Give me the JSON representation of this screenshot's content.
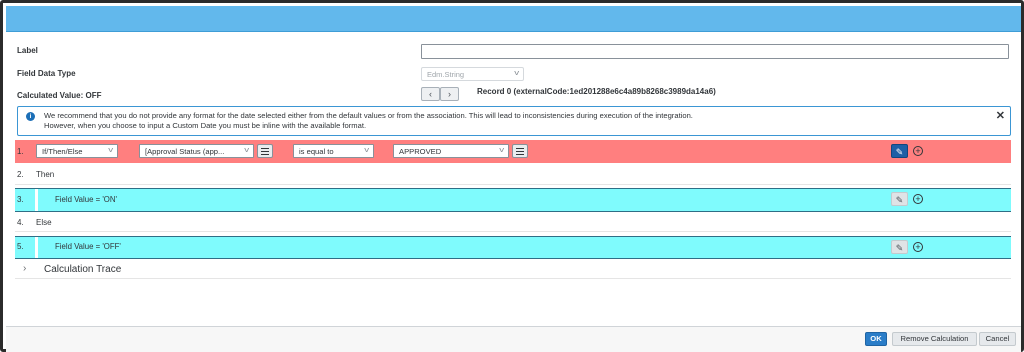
{
  "form": {
    "label_label": "Label",
    "label_value": "",
    "field_type_label": "Field Data Type",
    "field_type_value": "Edm.String",
    "calculated_value_label": "Calculated Value: OFF",
    "record_label": "Record 0 (externalCode:1ed201288e6c4a89b8268c3989da14a6)",
    "nav_prev": "‹",
    "nav_next": "›"
  },
  "info": {
    "line1": "We recommend that you do not provide any format for the date selected either from the default values or from the association. This will lead to inconsistencies during execution of the integration.",
    "line2": "However, when you choose to input a Custom Date you must be inline with the available format.",
    "icon": "info-icon",
    "close_icon": "close-icon"
  },
  "rows": {
    "r1": {
      "num": "1.",
      "type": "If/Then/Else",
      "field": "[Approval Status (app...",
      "operator": "is equal to",
      "value": "APPROVED"
    },
    "r2": {
      "num": "2.",
      "text": "Then"
    },
    "r3": {
      "num": "3.",
      "text": "Field Value = 'ON'"
    },
    "r4": {
      "num": "4.",
      "text": "Else"
    },
    "r5": {
      "num": "5.",
      "text": "Field Value = 'OFF'"
    }
  },
  "trace": {
    "label": "Calculation Trace"
  },
  "footer": {
    "ok": "OK",
    "remove": "Remove Calculation",
    "cancel": "Cancel"
  },
  "colors": {
    "condition_row": "#ff7f7f",
    "value_row": "#7ffbfd",
    "accent": "#2a7dc8",
    "title_bar": "#62b8ec"
  }
}
